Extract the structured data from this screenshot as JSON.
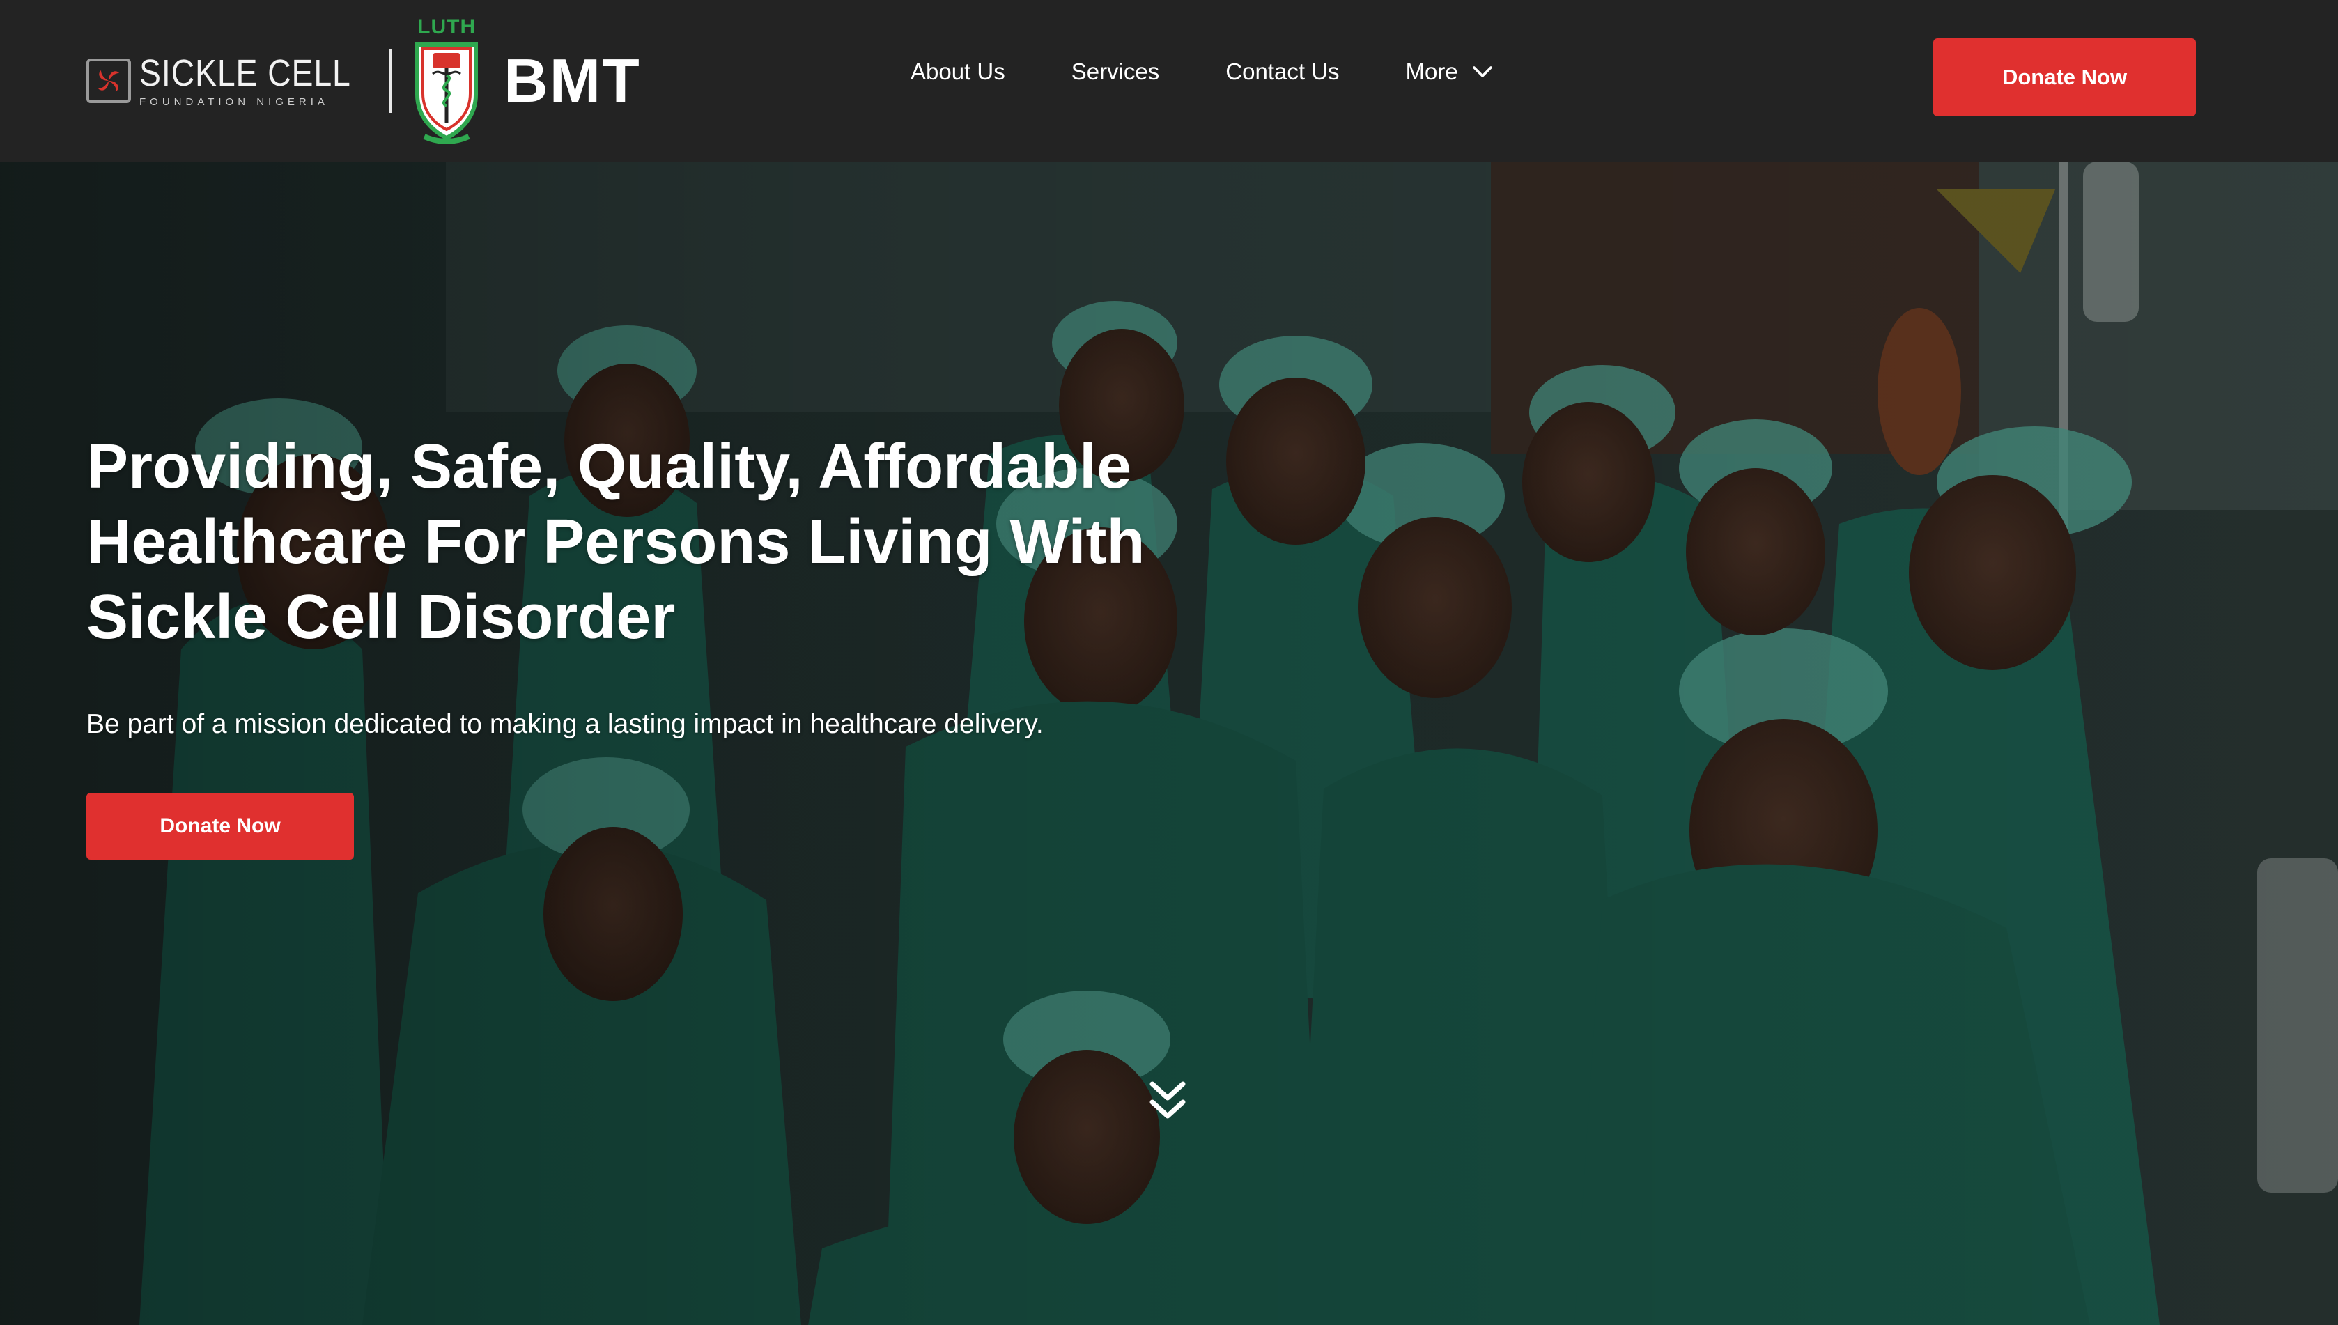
{
  "header": {
    "logo_scfn": {
      "title": "SICKLE CELL",
      "subtitle": "FOUNDATION NIGERIA"
    },
    "logo_luth": {
      "label": "LUTH"
    },
    "brand_name": "BMT",
    "nav": [
      {
        "label": "About Us"
      },
      {
        "label": "Services"
      },
      {
        "label": "Contact Us"
      },
      {
        "label": "More"
      }
    ],
    "donate_label": "Donate Now"
  },
  "hero": {
    "title": "Providing, Safe, Quality, Affordable Healthcare For Persons Living With Sickle Cell Disorder",
    "subtitle": "Be part of a mission dedicated to making a lasting impact in healthcare delivery.",
    "donate_label": "Donate Now",
    "scroll_icon": "double-chevron-down-icon"
  },
  "colors": {
    "navbar_bg": "#232323",
    "accent_red": "#e0302f",
    "scrub_green": "#1f6b5b",
    "luth_green": "#2fa84f"
  }
}
